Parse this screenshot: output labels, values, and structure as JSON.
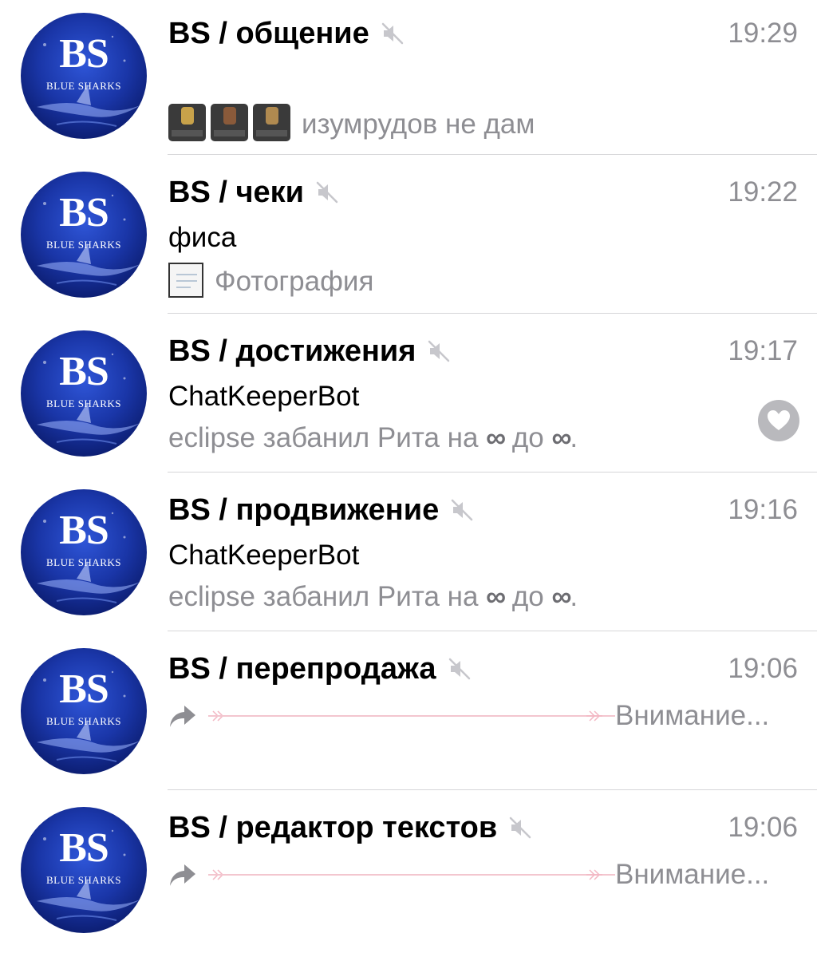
{
  "colors": {
    "secondary_text": "#8e8e93",
    "avatar_blue": "#1a36a8",
    "separator": "#d6d6d8",
    "forward_line_pink": "#f3c6cf"
  },
  "avatar": {
    "initials": "BS",
    "subtitle": "BLUE SHARKS"
  },
  "chats": [
    {
      "title": "BS / общение",
      "muted": true,
      "time": "19:29",
      "sender": "",
      "preview": "изумрудов не дам",
      "attachment": "three-photo-thumbnails"
    },
    {
      "title": "BS / чеки",
      "muted": true,
      "time": "19:22",
      "sender": "фиса",
      "preview": "Фотография",
      "attachment": "photo-thumbnail"
    },
    {
      "title": "BS / достижения",
      "muted": true,
      "time": "19:17",
      "sender": "ChatKeeperBot",
      "preview_start": "eclipse забанил Рита на ",
      "infinity": "∞",
      "preview_mid": " до ",
      "preview_end": ".",
      "reaction": "heart-icon"
    },
    {
      "title": "BS / продвижение",
      "muted": true,
      "time": "19:16",
      "sender": "ChatKeeperBot",
      "preview_start": "eclipse забанил Рита на ",
      "infinity": "∞",
      "preview_mid": " до ",
      "preview_end": "."
    },
    {
      "title": "BS / перепродажа",
      "muted": true,
      "time": "19:06",
      "forwarded": true,
      "preview": "Внимание..."
    },
    {
      "title": "BS / редактор текстов",
      "muted": true,
      "time": "19:06",
      "forwarded": true,
      "preview": "Внимание..."
    }
  ]
}
